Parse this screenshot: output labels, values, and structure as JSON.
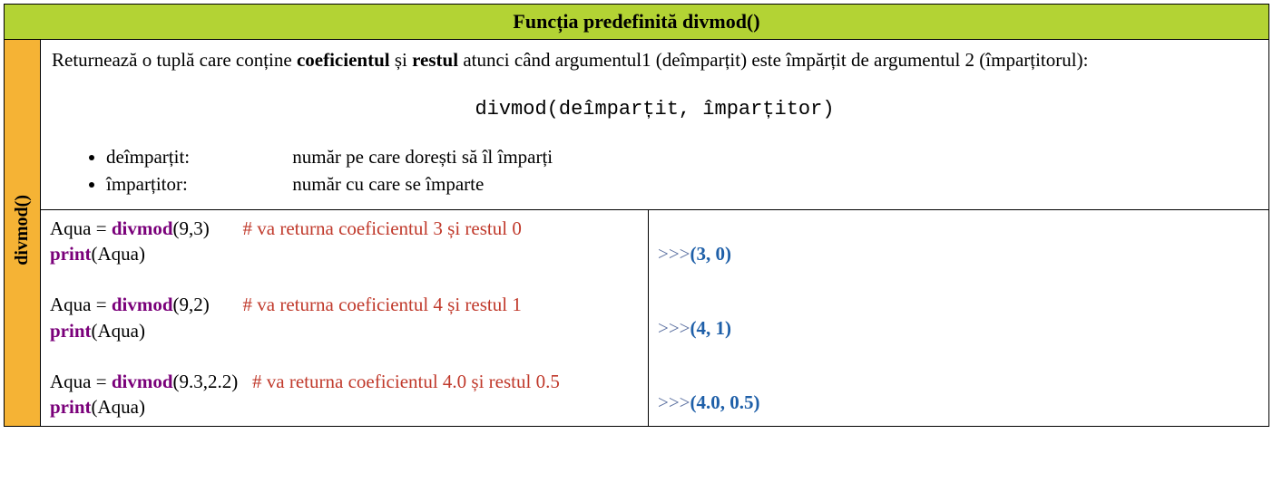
{
  "header": {
    "title": "Funcția predefinită divmod()"
  },
  "side_label": "divmod()",
  "description": {
    "before_bold1": "Returnează o tuplă care conține ",
    "bold1": "coeficientul",
    "between": " și ",
    "bold2": "restul",
    "after_bold2": " atunci când argumentul1 (deîmparțit) este împărțit de argumentul 2 (împarțitorul):"
  },
  "signature": "divmod(deîmparțit, împarțitor)",
  "params": [
    {
      "name": "deîmparțit:",
      "desc": "număr pe care dorești să îl împarți"
    },
    {
      "name": "împarțitor:",
      "desc": "număr cu care se împarte"
    }
  ],
  "code": {
    "var": "Aqua",
    "assign": " = ",
    "func": "divmod",
    "args1": "(9,3)",
    "comment1": "# va returna coeficientul 3 și restul 0",
    "print": "print",
    "printarg": "(Aqua)",
    "args2": "(9,2)",
    "comment2": "# va returna coeficientul 4 și restul 1",
    "args3": "(9.3,2.2)",
    "comment3": "# va returna coeficientul 4.0 și restul 0.5"
  },
  "output": {
    "prompt": ">>>",
    "tuple1": "(3, 0)",
    "tuple2": "(4, 1)",
    "tuple3": "(4.0, 0.5)"
  }
}
